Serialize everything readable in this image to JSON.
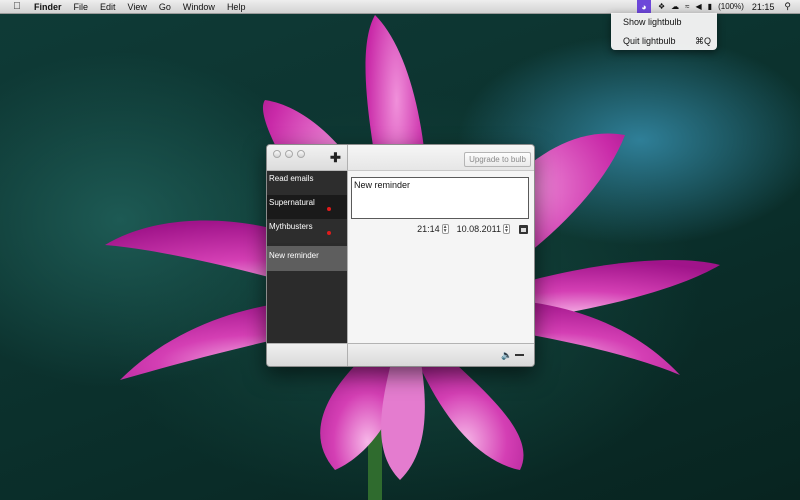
{
  "menubar": {
    "apple_icon": "apple-icon",
    "items": [
      "Finder",
      "File",
      "Edit",
      "View",
      "Go",
      "Window",
      "Help"
    ],
    "status": {
      "bulb_icon": "lightbulb-icon",
      "battery": "(100%)",
      "clock": "21:15"
    }
  },
  "status_menu": {
    "show": "Show lightbulb",
    "quit": "Quit lightbulb",
    "quit_shortcut": "⌘Q"
  },
  "window": {
    "add_symbol": "✚",
    "upgrade_label": "Upgrade to bulb",
    "reminders": [
      {
        "label": "Read emails",
        "flag": false
      },
      {
        "label": "Supernatural",
        "flag": true
      },
      {
        "label": "Mythbusters",
        "flag": true
      },
      {
        "label": "New reminder",
        "flag": false,
        "selected": true
      }
    ],
    "detail": {
      "text": "New reminder",
      "time": "21:14",
      "date": "10.08.2011"
    },
    "colors": {
      "sidebar": "#2b2b2b",
      "selected_row": "#5e5e5e",
      "flag_dot": "#e11b1b",
      "status_highlight": "#6d47d9"
    }
  }
}
